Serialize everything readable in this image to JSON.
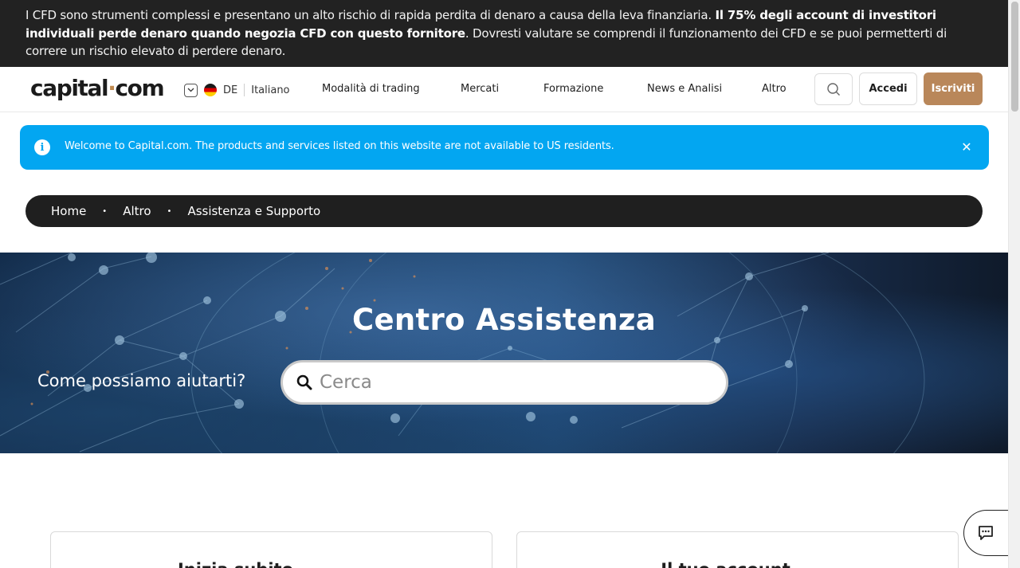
{
  "risk_warning": {
    "part1": "I CFD sono strumenti complessi e presentano un alto rischio di rapida perdita di denaro a causa della leva finanziaria. ",
    "bold": "Il 75% degli account di investitori individuali perde denaro quando negozia CFD con questo fornitore",
    "part2": ". Dovresti valutare se comprendi il funzionamento dei CFD e se puoi permetterti di correre un rischio elevato di perdere denaro."
  },
  "header": {
    "logo_main": "capital",
    "logo_dot": "·",
    "logo_tld": "com",
    "lang_code": "DE",
    "lang_name": "Italiano",
    "nav": [
      "Modalità di trading",
      "Mercati",
      "Formazione",
      "News e Analisi",
      "Altro"
    ],
    "login_label": "Accedi",
    "signup_label": "Iscriviti"
  },
  "alert": {
    "message": "Welcome to Capital.com. The products and services listed on this website are not available to US residents.",
    "close_symbol": "✕",
    "info_symbol": "i"
  },
  "breadcrumb": {
    "items": [
      "Home",
      "Altro",
      "Assistenza e Supporto"
    ],
    "separator": "•"
  },
  "hero": {
    "title": "Centro Assistenza",
    "prompt": "Come possiamo aiutarti?",
    "search_placeholder": "Cerca"
  },
  "cards": [
    {
      "title": "Inizia subito"
    },
    {
      "title": "Il tuo account"
    }
  ],
  "colors": {
    "risk_bg": "#222222",
    "alert_bg": "#03a6f1",
    "signup_bg": "#b9875a",
    "breadcrumb_bg": "#1f1f1f"
  }
}
